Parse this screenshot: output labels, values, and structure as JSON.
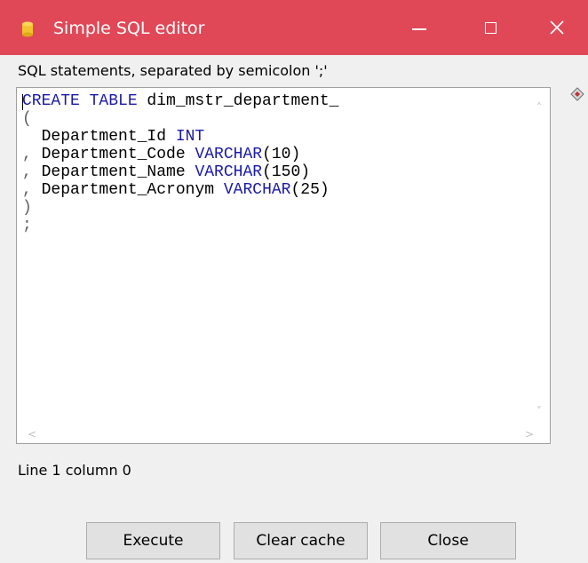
{
  "window": {
    "title": "Simple SQL editor",
    "app_icon": "database-icon",
    "titlebar_color": "#e04858",
    "controls": [
      "minimize-icon",
      "maximize-icon",
      "close-icon"
    ]
  },
  "instructions": "SQL statements, separated by semicolon ';'",
  "editor": {
    "lines": [
      {
        "tokens": [
          {
            "t": "CREATE TABLE",
            "k": "kw"
          },
          {
            "t": " dim_mstr_department_",
            "k": "plain"
          }
        ]
      },
      {
        "tokens": [
          {
            "t": "(",
            "k": "punct"
          }
        ]
      },
      {
        "tokens": [
          {
            "t": "  Department_Id ",
            "k": "plain"
          },
          {
            "t": "INT",
            "k": "kw"
          }
        ]
      },
      {
        "tokens": [
          {
            "t": ",",
            "k": "punct"
          },
          {
            "t": " Department_Code ",
            "k": "plain"
          },
          {
            "t": "VARCHAR",
            "k": "kw"
          },
          {
            "t": "(10)",
            "k": "plain"
          }
        ]
      },
      {
        "tokens": [
          {
            "t": ",",
            "k": "punct"
          },
          {
            "t": " Department_Name ",
            "k": "plain"
          },
          {
            "t": "VARCHAR",
            "k": "kw"
          },
          {
            "t": "(150)",
            "k": "plain"
          }
        ]
      },
      {
        "tokens": [
          {
            "t": ",",
            "k": "punct"
          },
          {
            "t": " Department_Acronym ",
            "k": "plain"
          },
          {
            "t": "VARCHAR",
            "k": "kw"
          },
          {
            "t": "(25)",
            "k": "plain"
          }
        ]
      },
      {
        "tokens": [
          {
            "t": ")",
            "k": "punct"
          }
        ]
      },
      {
        "tokens": [
          {
            "t": ";",
            "k": "punct"
          }
        ]
      }
    ],
    "keyword_color": "#1a1aa8"
  },
  "status": "Line 1 column 0",
  "buttons": {
    "execute": "Execute",
    "clear_cache": "Clear cache",
    "close": "Close"
  }
}
